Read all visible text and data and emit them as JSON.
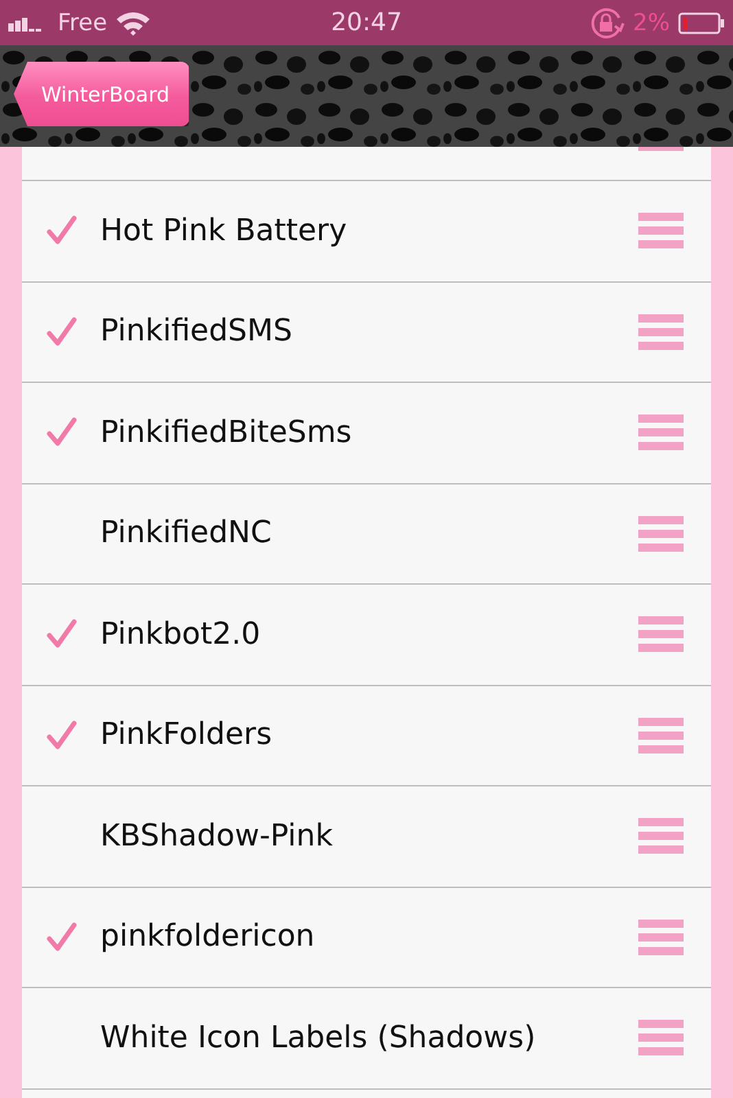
{
  "status_bar": {
    "carrier": "Free",
    "time": "20:47",
    "battery_percent": "2%"
  },
  "nav_bar": {
    "back_button": "WinterBoard"
  },
  "themes": [
    {
      "name": "Hot Pink Battery",
      "checked": true
    },
    {
      "name": "PinkifiedSMS",
      "checked": true
    },
    {
      "name": "PinkifiedBiteSms",
      "checked": true
    },
    {
      "name": "PinkifiedNC",
      "checked": false
    },
    {
      "name": "Pinkbot2.0",
      "checked": true
    },
    {
      "name": "PinkFolders",
      "checked": true
    },
    {
      "name": "KBShadow-Pink",
      "checked": false
    },
    {
      "name": "pinkfoldericon",
      "checked": true
    },
    {
      "name": "White Icon Labels (Shadows)",
      "checked": false
    }
  ]
}
